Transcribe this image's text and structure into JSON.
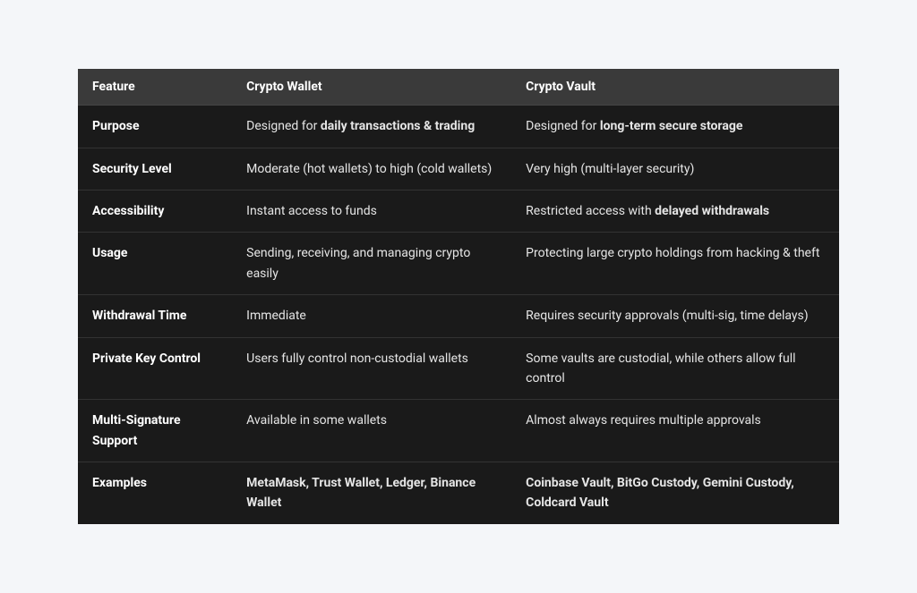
{
  "chart_data": {
    "type": "table",
    "title": "",
    "headers": [
      "Feature",
      "Crypto Wallet",
      "Crypto Vault"
    ],
    "rows": [
      {
        "feature": "Purpose",
        "wallet_prefix": "Designed for ",
        "wallet_bold": "daily transactions & trading",
        "wallet_suffix": "",
        "vault_prefix": "Designed for ",
        "vault_bold": "long-term secure storage",
        "vault_suffix": ""
      },
      {
        "feature": "Security Level",
        "wallet_prefix": "Moderate (hot wallets) to high (cold wallets)",
        "wallet_bold": "",
        "wallet_suffix": "",
        "vault_prefix": "Very high (multi-layer security)",
        "vault_bold": "",
        "vault_suffix": ""
      },
      {
        "feature": "Accessibility",
        "wallet_prefix": "Instant access to funds",
        "wallet_bold": "",
        "wallet_suffix": "",
        "vault_prefix": "Restricted access with ",
        "vault_bold": "delayed withdrawals",
        "vault_suffix": ""
      },
      {
        "feature": "Usage",
        "wallet_prefix": "Sending, receiving, and managing crypto easily",
        "wallet_bold": "",
        "wallet_suffix": "",
        "vault_prefix": "Protecting large crypto holdings from hacking & theft",
        "vault_bold": "",
        "vault_suffix": ""
      },
      {
        "feature": "Withdrawal Time",
        "wallet_prefix": "Immediate",
        "wallet_bold": "",
        "wallet_suffix": "",
        "vault_prefix": "Requires security approvals (multi-sig, time delays)",
        "vault_bold": "",
        "vault_suffix": ""
      },
      {
        "feature": "Private Key Control",
        "wallet_prefix": "Users fully control non-custodial wallets",
        "wallet_bold": "",
        "wallet_suffix": "",
        "vault_prefix": "Some vaults are custodial, while others allow full control",
        "vault_bold": "",
        "vault_suffix": ""
      },
      {
        "feature": "Multi-Signature Support",
        "wallet_prefix": "Available in some wallets",
        "wallet_bold": "",
        "wallet_suffix": "",
        "vault_prefix": "Almost always requires multiple approvals",
        "vault_bold": "",
        "vault_suffix": ""
      },
      {
        "feature": "Examples",
        "wallet_prefix": "",
        "wallet_bold": "MetaMask, Trust Wallet, Ledger, Binance Wallet",
        "wallet_suffix": "",
        "vault_prefix": "",
        "vault_bold": "Coinbase Vault, BitGo Custody, Gemini Custody, Coldcard Vault",
        "vault_suffix": ""
      }
    ]
  }
}
